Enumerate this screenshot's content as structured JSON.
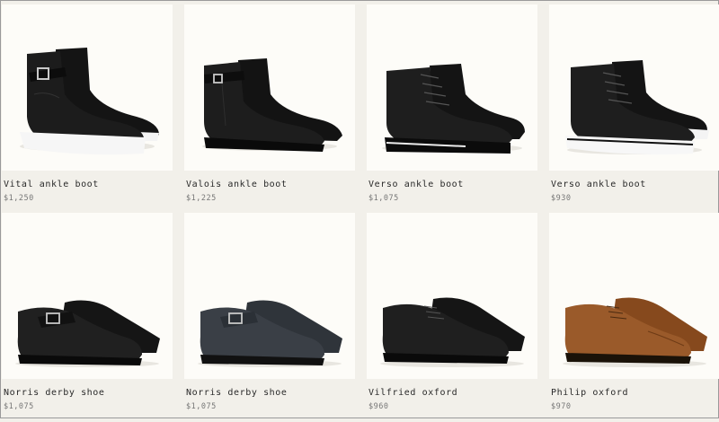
{
  "products": [
    {
      "name": "Vital ankle boot",
      "price": "$1,250",
      "image": "black-ankle-boot-buckle-white-sole"
    },
    {
      "name": "Valois ankle boot",
      "price": "$1,225",
      "image": "black-ankle-boot-buckle"
    },
    {
      "name": "Verso ankle boot",
      "price": "$1,075",
      "image": "black-lace-up-boot-black-sole"
    },
    {
      "name": "Verso ankle boot",
      "price": "$930",
      "image": "black-lace-up-boot-white-sole"
    },
    {
      "name": "Norris derby shoe",
      "price": "$1,075",
      "image": "black-monk-strap-shoe"
    },
    {
      "name": "Norris derby shoe",
      "price": "$1,075",
      "image": "dark-grey-monk-strap-shoe"
    },
    {
      "name": "Vilfried oxford",
      "price": "$960",
      "image": "black-oxford-shoe"
    },
    {
      "name": "Philip oxford",
      "price": "$970",
      "image": "tan-oxford-shoe"
    }
  ],
  "colors": {
    "card_bg": "#fdfcf8",
    "page_bg": "#f2f0ea",
    "black_leather": "#1c1c1c",
    "grey_leather": "#3a3f46",
    "tan_leather": "#9a5a2a"
  }
}
